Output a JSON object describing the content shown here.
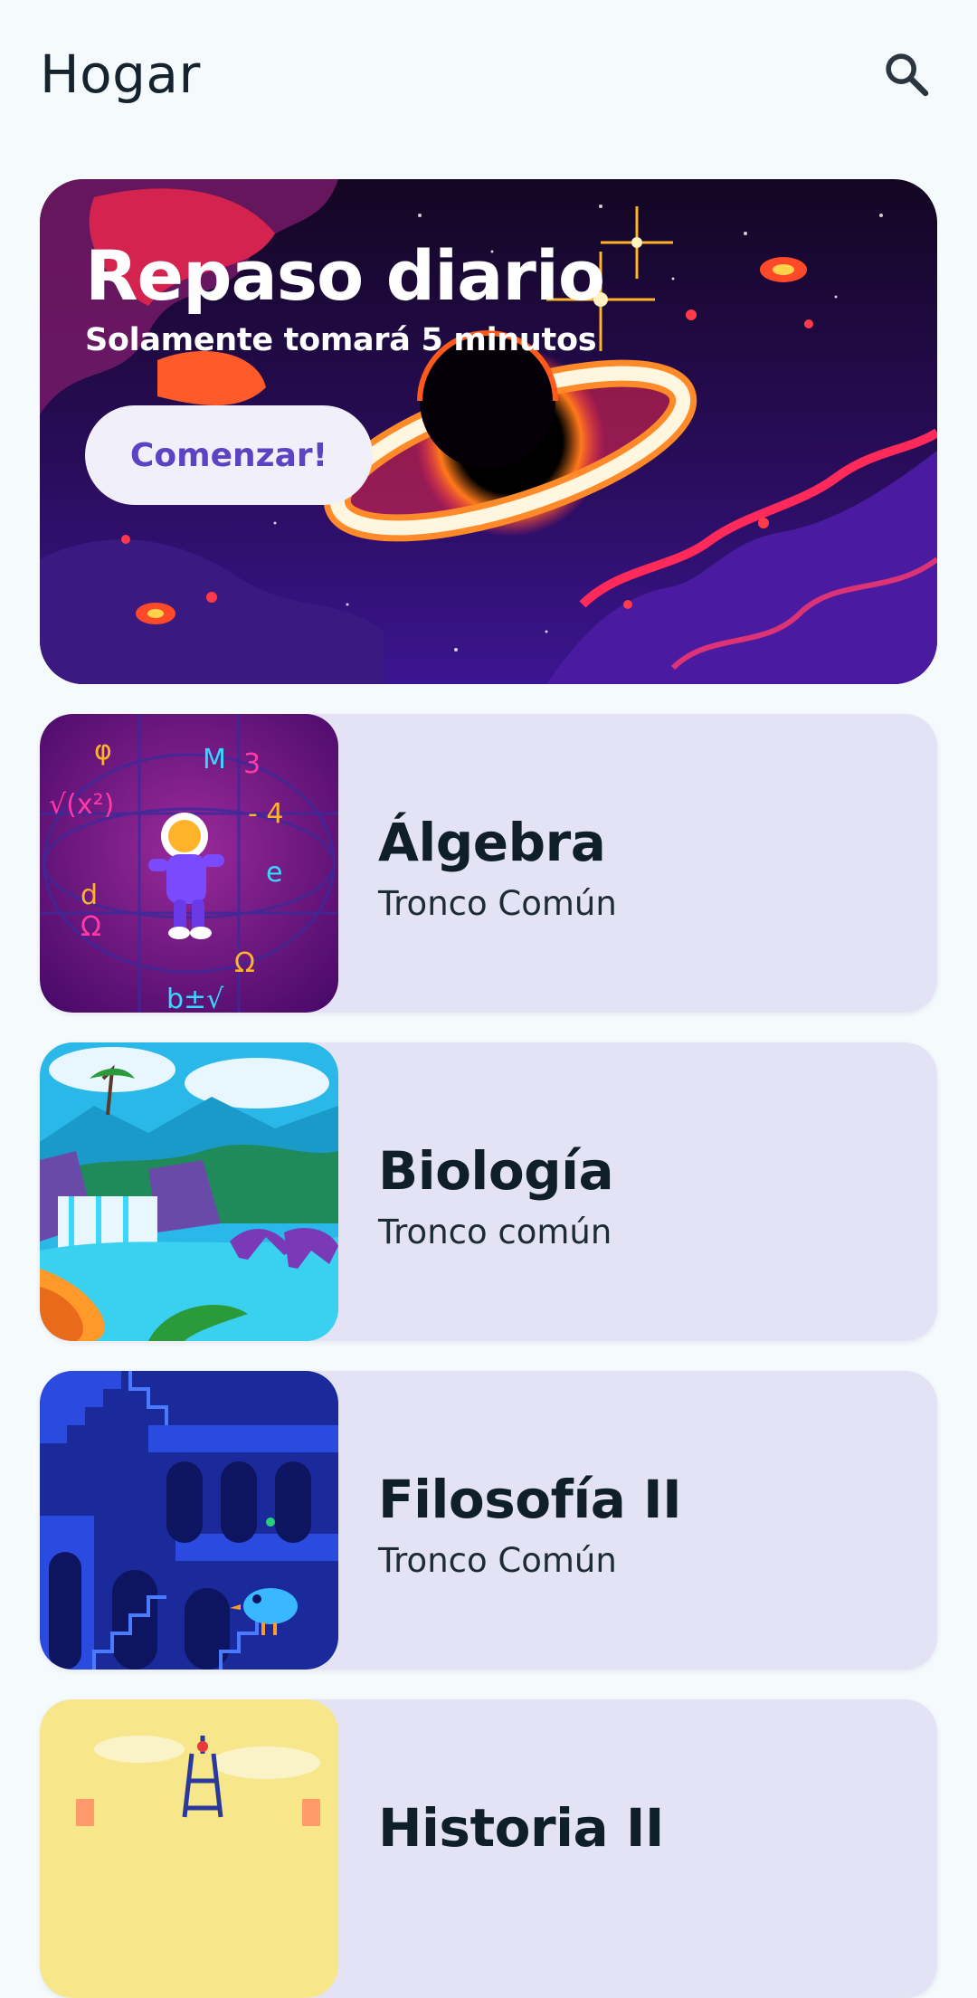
{
  "app_bar": {
    "title": "Hogar",
    "search_icon": "search-icon"
  },
  "hero": {
    "title": "Repaso diario",
    "subtitle": "Solamente tomará 5 minutos",
    "button_label": "Comenzar!",
    "illustration": "black-hole-space-illustration"
  },
  "courses": [
    {
      "title": "Álgebra",
      "subtitle": "Tronco Común",
      "illustration": "astronaut-math-illustration"
    },
    {
      "title": "Biología",
      "subtitle": "Tronco común",
      "illustration": "waterfall-dinosaur-illustration"
    },
    {
      "title": "Filosofía II",
      "subtitle": "Tronco Común",
      "illustration": "escher-stairs-bird-illustration"
    },
    {
      "title": "Historia II",
      "subtitle": "",
      "illustration": "eiffel-tower-illustration"
    }
  ],
  "colors": {
    "background": "#f5fafd",
    "card": "#e3e3f5",
    "accent": "#5b43c3"
  }
}
